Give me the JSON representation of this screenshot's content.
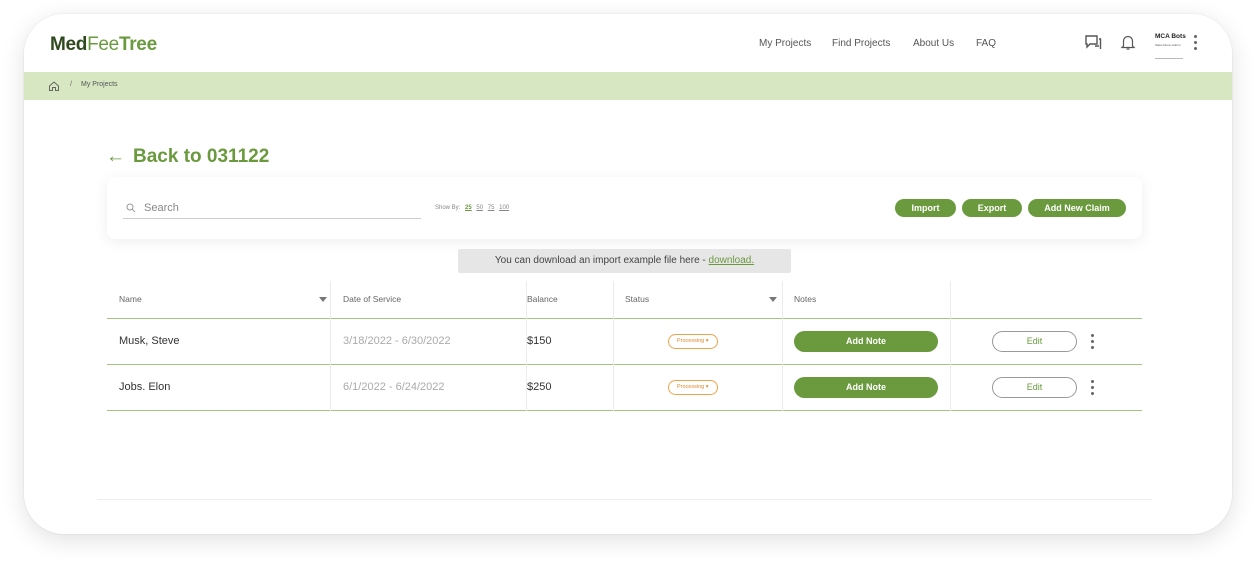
{
  "brand": {
    "part1": "Med",
    "part2": "Fee",
    "part3": "Tree"
  },
  "nav": {
    "items": [
      {
        "label": "My Projects"
      },
      {
        "label": "Find Projects"
      },
      {
        "label": "About Us"
      },
      {
        "label": "FAQ"
      }
    ]
  },
  "user": {
    "name": "MCA Bots",
    "subtitle": "Sales Demo Admin"
  },
  "breadcrumb": {
    "separator": "/",
    "current": "My Projects"
  },
  "page": {
    "back_arrow": "←",
    "back_label": "Back to 031122"
  },
  "toolbar": {
    "search_placeholder": "Search",
    "show_by_label": "Show By:",
    "show_by_options": [
      "25",
      "50",
      "75",
      "100"
    ],
    "show_by_selected": "25",
    "import_label": "Import",
    "export_label": "Export",
    "add_claim_label": "Add New Claim"
  },
  "banner": {
    "text": "You can download an import example file here - ",
    "link": "download."
  },
  "table": {
    "columns": [
      "Name",
      "Date of Service",
      "Balance",
      "Status",
      "Notes"
    ],
    "rows": [
      {
        "name": "Musk, Steve",
        "date": "3/18/2022 - 6/30/2022",
        "balance": "$150",
        "status": "Processing ▾",
        "note_label": "Add Note",
        "edit_label": "Edit"
      },
      {
        "name": "Jobs. Elon",
        "date": "6/1/2022 - 6/24/2022",
        "balance": "$250",
        "status": "Processing ▾",
        "note_label": "Add Note",
        "edit_label": "Edit"
      }
    ]
  },
  "colors": {
    "brand_green": "#6a9a3d",
    "brand_dark": "#2f4a1f",
    "breadcrumb_bg": "#d6e7c2",
    "status_orange": "#f0a24a"
  },
  "icons": [
    "chat-icon",
    "bell-icon",
    "kebab-menu-icon",
    "home-icon",
    "search-icon",
    "back-arrow-icon",
    "caret-down-icon"
  ]
}
